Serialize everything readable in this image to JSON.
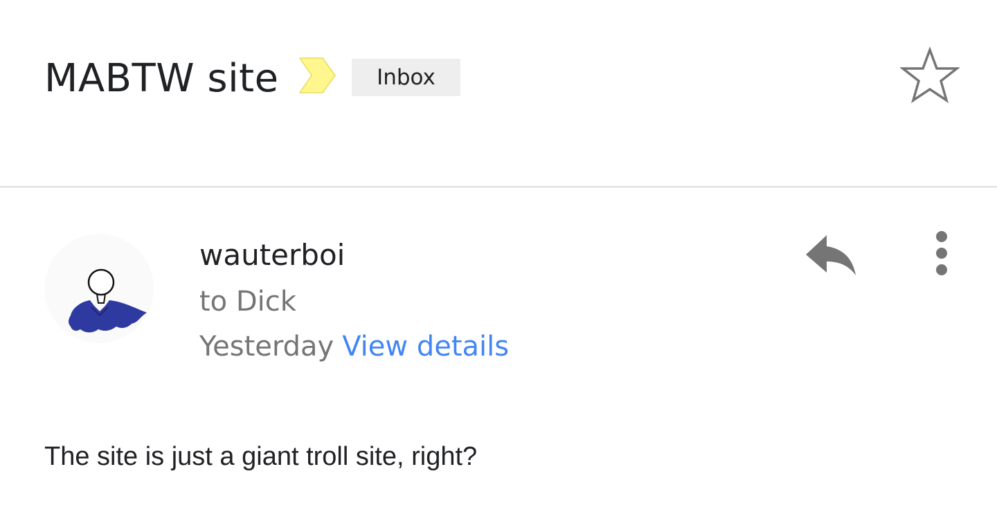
{
  "thread": {
    "subject": "MABTW site",
    "label": "Inbox",
    "importance_icon": "importance-marker-icon",
    "importance_color": "#fff68e",
    "star_icon": "star-outline-icon"
  },
  "message": {
    "sender": "wauterboi",
    "recipient": "to Dick",
    "date": "Yesterday",
    "view_details": "View details",
    "avatar_icon": "person-avatar-icon",
    "reply_icon": "reply-icon",
    "more_icon": "more-vert-icon",
    "body": "The site is just a giant troll site, right?"
  },
  "colors": {
    "link": "#4285f4",
    "secondary_text": "#757575",
    "chip_bg": "#eeeeee",
    "divider": "#dcdcdc",
    "avatar_shirt": "#2f3aa0",
    "icon_gray": "#757575"
  }
}
